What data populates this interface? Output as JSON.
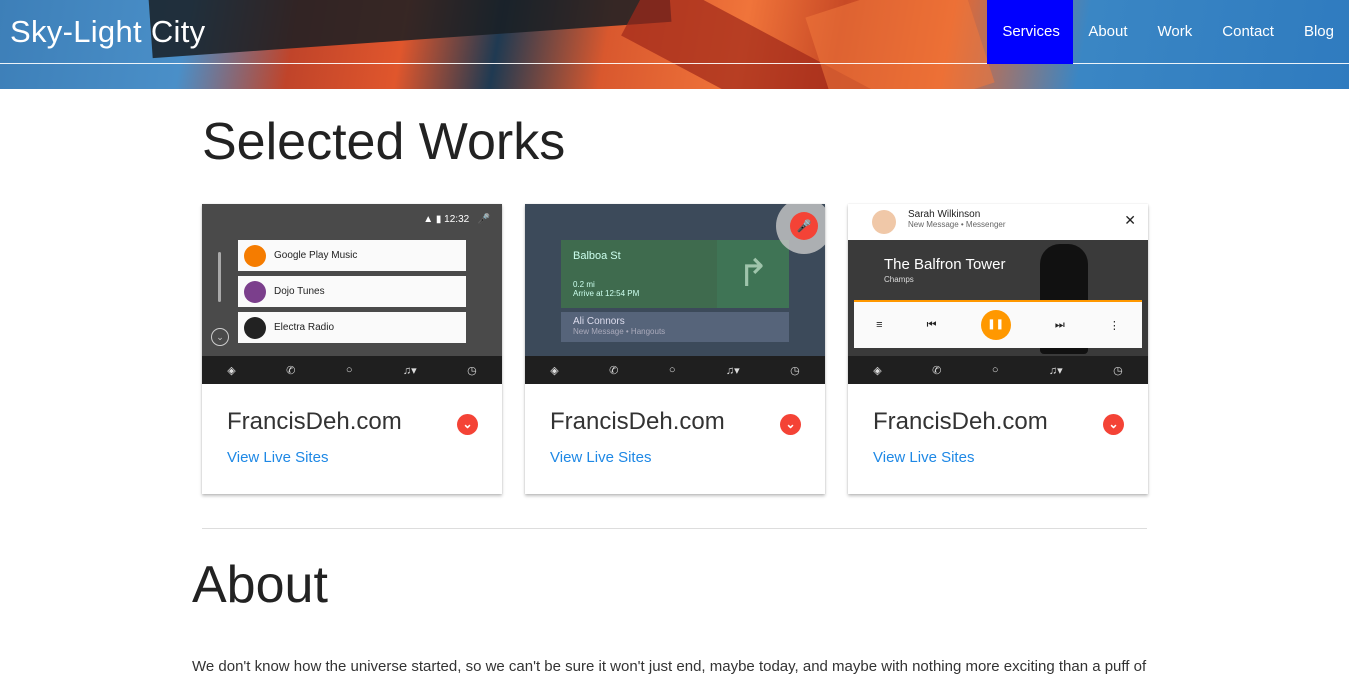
{
  "header": {
    "brand": "Sky-Light City",
    "nav": [
      "Services",
      "About",
      "Work",
      "Contact",
      "Blog"
    ],
    "active_nav": "Services",
    "active_color": "#0000ff"
  },
  "works": {
    "title": "Selected Works",
    "cards": [
      {
        "title": "FrancisDeh.com",
        "link": "View Live Sites",
        "screen": {
          "time": "12:32",
          "items": [
            "Google Play Music",
            "Dojo Tunes",
            "Electra Radio"
          ]
        }
      },
      {
        "title": "FrancisDeh.com",
        "link": "View Live Sites",
        "screen": {
          "destination": "Balboa St",
          "distance": "0.2 mi",
          "arrive": "Arrive at 12:54 PM",
          "message_from": "Ali Connors",
          "message_meta": "New Message • Hangouts"
        }
      },
      {
        "title": "FrancisDeh.com",
        "link": "View Live Sites",
        "screen": {
          "sender": "Sarah Wilkinson",
          "sender_meta": "New Message • Messenger",
          "song": "The Balfron Tower",
          "artist": "Champs"
        }
      }
    ]
  },
  "about": {
    "title": "About",
    "text": "We don't know how the universe started, so we can't be sure it won't just end, maybe today, and maybe with nothing more exciting than a puff of"
  },
  "colors": {
    "link": "#1e88e5",
    "accent_red": "#f44336",
    "accent_orange": "#ff9800"
  }
}
